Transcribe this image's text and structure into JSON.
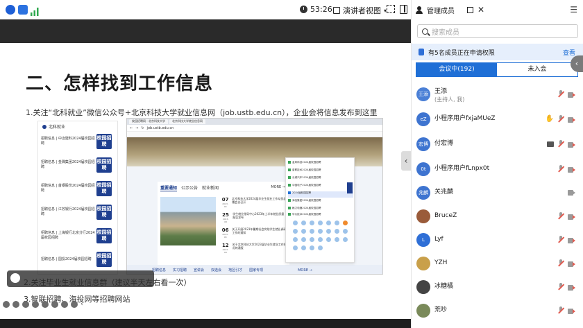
{
  "topbar": {
    "timer": "53:26",
    "presenter_view": "演讲者视图"
  },
  "panel": {
    "title": "管理成员",
    "search_placeholder": "搜索成员",
    "applying_text": "有5名成员正在申请权限",
    "view_link": "查看",
    "tab_in_meeting": "会议中(192)",
    "tab_not_joined": "未入会",
    "members": [
      {
        "name": "王添",
        "role": "(主持人, 我)",
        "avatar": "王添",
        "color": "#4a7fd6"
      },
      {
        "name": "小程序用户fxjaMUeZ",
        "role": "",
        "avatar": "eZ",
        "color": "#3e74d0"
      },
      {
        "name": "付宏博",
        "role": "",
        "avatar": "宏博",
        "color": "#3e74d0"
      },
      {
        "name": "小程序用户fLnpx0t",
        "role": "",
        "avatar": "0t",
        "color": "#3e74d0"
      },
      {
        "name": "关兆麟",
        "role": "",
        "avatar": "兆麟",
        "color": "#3e74d0"
      },
      {
        "name": "BruceZ",
        "role": "",
        "avatar": "",
        "color": "#9a5b3a"
      },
      {
        "name": "Lyf",
        "role": "",
        "avatar": "L",
        "color": "#2f6fd6"
      },
      {
        "name": "YZH",
        "role": "",
        "avatar": "",
        "color": "#c9a04a"
      },
      {
        "name": "冰糖橘",
        "role": "",
        "avatar": "",
        "color": "#444"
      },
      {
        "name": "荒吵",
        "role": "",
        "avatar": "",
        "color": "#7a8a5a"
      }
    ]
  },
  "slide": {
    "title": "二、怎样找到工作信息",
    "line1": "1.关注“北科就业”微信公众号+北京科技大学就业信息网（job.ustb.edu.cn），企业会将信息发布到这里",
    "line2": "2.关注毕业生就业信息群（建议半天左右看一次）",
    "line3": "3.智联招聘、海投网等招聘网站",
    "phone_header": "北科就业",
    "phone_items": [
      "招聘信息 | 中冶建科2024届校园招聘",
      "招聘信息 | 金隅集团2024届校园招聘",
      "招聘信息 | 首钢股份2024届校园招聘",
      "招聘信息 | 江苏银行2024届校园招聘",
      "招聘信息 | 上海银行北京分行2024届校园招聘",
      "招聘信息 | 国投2024届校园招聘"
    ],
    "phone_badge": "校园招聘",
    "browser": {
      "address": "job.ustb.edu.cn",
      "tabs": [
        "校园招聘网 - 北京科技大学",
        "北京科技大学就业信息网"
      ],
      "notice_tabs": [
        "重要通知",
        "公示公告",
        "就业新闻"
      ],
      "more": "MORE →",
      "notices": [
        {
          "day": "07",
          "month": "2023-09",
          "text": "北京科技大学2024届毕业生就业工作动员部署会议召开"
        },
        {
          "day": "25",
          "month": "2023-08",
          "text": "学生就业指导中心2023年上半年就业质量报告发布"
        },
        {
          "day": "06",
          "month": "2023-08",
          "text": "关于开展2023年暑期社会实践学生就业调研工作的通知"
        },
        {
          "day": "12",
          "month": "2023-08",
          "text": "关于北京科技大学2023届毕业生就业工作情况的通报"
        }
      ],
      "footer_links": [
        "招聘信息",
        "实习招聘",
        "宣讲会",
        "双选会",
        "地区引才",
        "国家专项",
        "MORE →"
      ],
      "popup_items": [
        "金风科技2024届校园招聘",
        "普联技术2024届校园招聘",
        "长城汽车2024届校园招聘",
        "中国电子2024届校园招聘",
        "2024届校园招聘",
        "海信集团2024届校园招聘",
        "格力电器2024届校园招聘",
        "华为技术2024届校园招聘"
      ]
    }
  }
}
